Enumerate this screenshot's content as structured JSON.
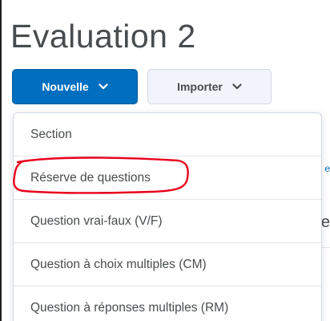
{
  "page": {
    "title": "Evaluation 2"
  },
  "toolbar": {
    "new_label": "Nouvelle",
    "import_label": "Importer"
  },
  "dropdown": {
    "items": [
      {
        "label": "Section"
      },
      {
        "label": "Réserve de questions"
      },
      {
        "label": "Question vrai-faux (V/F)"
      },
      {
        "label": "Question à choix multiples (CM)"
      },
      {
        "label": "Question à réponses multiples (RM)"
      }
    ],
    "highlighted_item": "Réserve de questions"
  },
  "background": {
    "partial_glyphs": [
      "e",
      "e"
    ]
  },
  "colors": {
    "primary_button": "#006fbf",
    "secondary_button": "#f1f5fb",
    "text": "#494c4e",
    "annotation": "#e8001c"
  },
  "icons": {
    "new_chevron": "chevron-down-icon",
    "import_chevron": "chevron-down-icon"
  }
}
